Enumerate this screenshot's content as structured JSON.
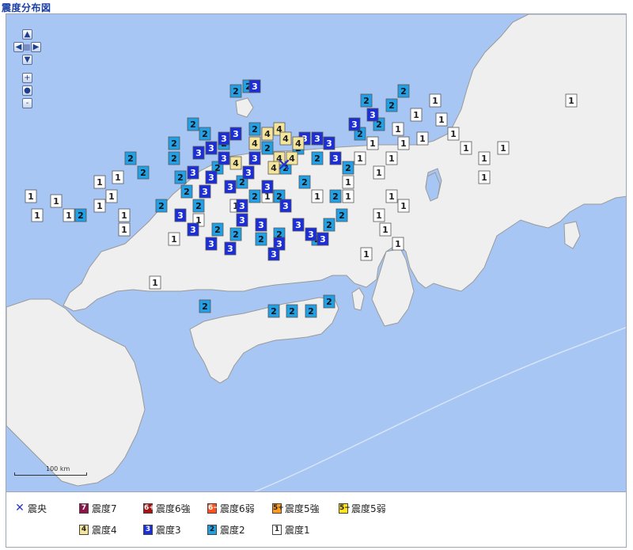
{
  "title": "震度分布図",
  "colors": {
    "sea": "#a7c6f3",
    "land": "#efefef",
    "coast": "#9a9a9a",
    "epicenter": "#2433c7",
    "int1": "#ffffff",
    "int2": "#22a0e6",
    "int3": "#1c2ed8",
    "int4": "#f5e59b",
    "int5m": "#ffe31b",
    "int5p": "#ff9a1b",
    "int6m": "#ff5218",
    "int6p": "#a41212",
    "int7": "#8c1448"
  },
  "controls": {
    "pan_up": "▲",
    "pan_left": "◀",
    "pan_right": "▶",
    "pan_down": "▼",
    "zoom_in": "+",
    "zoom_reset": "●",
    "zoom_out": "-"
  },
  "scale_label": "100 km",
  "epicenter": {
    "symbol": "✕"
  },
  "intensity_markers": {
    "1": [
      [
        "a",
        0.04,
        0.38
      ],
      [
        "a",
        0.08,
        0.39
      ],
      [
        "a",
        0.1,
        0.42
      ],
      [
        "a",
        0.15,
        0.35
      ],
      [
        "a",
        0.15,
        0.4
      ],
      [
        "a",
        0.17,
        0.38
      ],
      [
        "a",
        0.18,
        0.34
      ],
      [
        "a",
        0.05,
        0.42
      ],
      [
        "a",
        0.19,
        0.42
      ],
      [
        "a",
        0.19,
        0.45
      ],
      [
        "a",
        0.27,
        0.47
      ],
      [
        "a",
        0.24,
        0.56
      ],
      [
        "a",
        0.31,
        0.43
      ],
      [
        "a",
        0.37,
        0.4
      ],
      [
        "a",
        0.42,
        0.38
      ],
      [
        "a",
        0.5,
        0.38
      ],
      [
        "a",
        0.55,
        0.38
      ],
      [
        "a",
        0.6,
        0.33
      ],
      [
        "a",
        0.62,
        0.3
      ],
      [
        "a",
        0.64,
        0.27
      ],
      [
        "a",
        0.62,
        0.38
      ],
      [
        "a",
        0.64,
        0.4
      ],
      [
        "a",
        0.6,
        0.42
      ],
      [
        "a",
        0.61,
        0.45
      ],
      [
        "a",
        0.63,
        0.48
      ],
      [
        "a",
        0.58,
        0.5
      ],
      [
        "a",
        0.55,
        0.35
      ],
      [
        "a",
        0.57,
        0.3
      ],
      [
        "a",
        0.59,
        0.27
      ],
      [
        "a",
        0.63,
        0.24
      ],
      [
        "a",
        0.66,
        0.21
      ],
      [
        "a",
        0.69,
        0.18
      ],
      [
        "a",
        0.7,
        0.22
      ],
      [
        "a",
        0.72,
        0.25
      ],
      [
        "a",
        0.74,
        0.28
      ],
      [
        "a",
        0.77,
        0.34
      ],
      [
        "a",
        0.91,
        0.18
      ],
      [
        "a",
        0.77,
        0.3
      ],
      [
        "a",
        0.8,
        0.28
      ],
      [
        "a",
        0.67,
        0.26
      ]
    ],
    "2": [
      [
        "b",
        0.37,
        0.16
      ],
      [
        "b",
        0.39,
        0.15
      ],
      [
        "b",
        0.2,
        0.3
      ],
      [
        "b",
        0.22,
        0.33
      ],
      [
        "b",
        0.27,
        0.3
      ],
      [
        "b",
        0.28,
        0.34
      ],
      [
        "b",
        0.29,
        0.37
      ],
      [
        "b",
        0.31,
        0.4
      ],
      [
        "b",
        0.25,
        0.4
      ],
      [
        "b",
        0.12,
        0.42
      ],
      [
        "b",
        0.34,
        0.45
      ],
      [
        "b",
        0.37,
        0.46
      ],
      [
        "b",
        0.41,
        0.47
      ],
      [
        "b",
        0.44,
        0.46
      ],
      [
        "b",
        0.5,
        0.47
      ],
      [
        "b",
        0.52,
        0.44
      ],
      [
        "b",
        0.54,
        0.42
      ],
      [
        "b",
        0.53,
        0.38
      ],
      [
        "b",
        0.55,
        0.32
      ],
      [
        "b",
        0.57,
        0.25
      ],
      [
        "b",
        0.6,
        0.23
      ],
      [
        "b",
        0.62,
        0.19
      ],
      [
        "b",
        0.64,
        0.16
      ],
      [
        "b",
        0.58,
        0.18
      ],
      [
        "b",
        0.48,
        0.35
      ],
      [
        "b",
        0.45,
        0.32
      ],
      [
        "b",
        0.42,
        0.28
      ],
      [
        "b",
        0.4,
        0.24
      ],
      [
        "b",
        0.47,
        0.28
      ],
      [
        "b",
        0.5,
        0.3
      ],
      [
        "b",
        0.35,
        0.27
      ],
      [
        "b",
        0.32,
        0.25
      ],
      [
        "b",
        0.3,
        0.23
      ],
      [
        "b",
        0.27,
        0.27
      ],
      [
        "b",
        0.34,
        0.32
      ],
      [
        "b",
        0.38,
        0.35
      ],
      [
        "b",
        0.32,
        0.61
      ],
      [
        "b",
        0.43,
        0.62
      ],
      [
        "b",
        0.46,
        0.62
      ],
      [
        "b",
        0.49,
        0.62
      ],
      [
        "b",
        0.52,
        0.6
      ],
      [
        "b",
        0.4,
        0.38
      ],
      [
        "b",
        0.44,
        0.38
      ]
    ],
    "3": [
      [
        "c",
        0.4,
        0.15
      ],
      [
        "c",
        0.37,
        0.25
      ],
      [
        "c",
        0.35,
        0.26
      ],
      [
        "c",
        0.33,
        0.28
      ],
      [
        "c",
        0.3,
        0.33
      ],
      [
        "c",
        0.32,
        0.37
      ],
      [
        "c",
        0.28,
        0.42
      ],
      [
        "c",
        0.3,
        0.45
      ],
      [
        "c",
        0.33,
        0.48
      ],
      [
        "c",
        0.36,
        0.49
      ],
      [
        "c",
        0.38,
        0.4
      ],
      [
        "c",
        0.42,
        0.36
      ],
      [
        "c",
        0.45,
        0.4
      ],
      [
        "c",
        0.47,
        0.44
      ],
      [
        "c",
        0.49,
        0.46
      ],
      [
        "c",
        0.51,
        0.47
      ],
      [
        "c",
        0.44,
        0.48
      ],
      [
        "c",
        0.43,
        0.5
      ],
      [
        "c",
        0.48,
        0.26
      ],
      [
        "c",
        0.5,
        0.26
      ],
      [
        "c",
        0.52,
        0.27
      ],
      [
        "c",
        0.53,
        0.3
      ],
      [
        "c",
        0.56,
        0.23
      ],
      [
        "c",
        0.59,
        0.21
      ],
      [
        "c",
        0.4,
        0.3
      ],
      [
        "c",
        0.39,
        0.33
      ],
      [
        "c",
        0.35,
        0.3
      ],
      [
        "c",
        0.31,
        0.29
      ],
      [
        "c",
        0.33,
        0.34
      ],
      [
        "c",
        0.36,
        0.36
      ],
      [
        "c",
        0.38,
        0.43
      ],
      [
        "c",
        0.41,
        0.44
      ]
    ],
    "4": [
      [
        "d",
        0.42,
        0.25
      ],
      [
        "d",
        0.44,
        0.24
      ],
      [
        "d",
        0.45,
        0.26
      ],
      [
        "d",
        0.47,
        0.27
      ],
      [
        "d",
        0.46,
        0.3
      ],
      [
        "d",
        0.44,
        0.3
      ],
      [
        "d",
        0.4,
        0.27
      ],
      [
        "d",
        0.37,
        0.31
      ],
      [
        "d",
        0.43,
        0.32
      ]
    ]
  },
  "epicenter_pos": [
    0.447,
    0.314
  ],
  "legend": [
    {
      "kind": "x",
      "label": "震央"
    },
    {
      "kind": "int7",
      "text": "7",
      "label": "震度7"
    },
    {
      "kind": "int6p",
      "text": "6+",
      "label": "震度6強"
    },
    {
      "kind": "int6m",
      "text": "6−",
      "label": "震度6弱"
    },
    {
      "kind": "int5p",
      "text": "5+",
      "label": "震度5強"
    },
    {
      "kind": "int5m",
      "text": "5−",
      "label": "震度5弱"
    },
    {
      "kind": "int4",
      "text": "4",
      "label": "震度4"
    },
    {
      "kind": "int3",
      "text": "3",
      "label": "震度3"
    },
    {
      "kind": "int2",
      "text": "2",
      "label": "震度2"
    },
    {
      "kind": "int1",
      "text": "1",
      "label": "震度1"
    }
  ]
}
